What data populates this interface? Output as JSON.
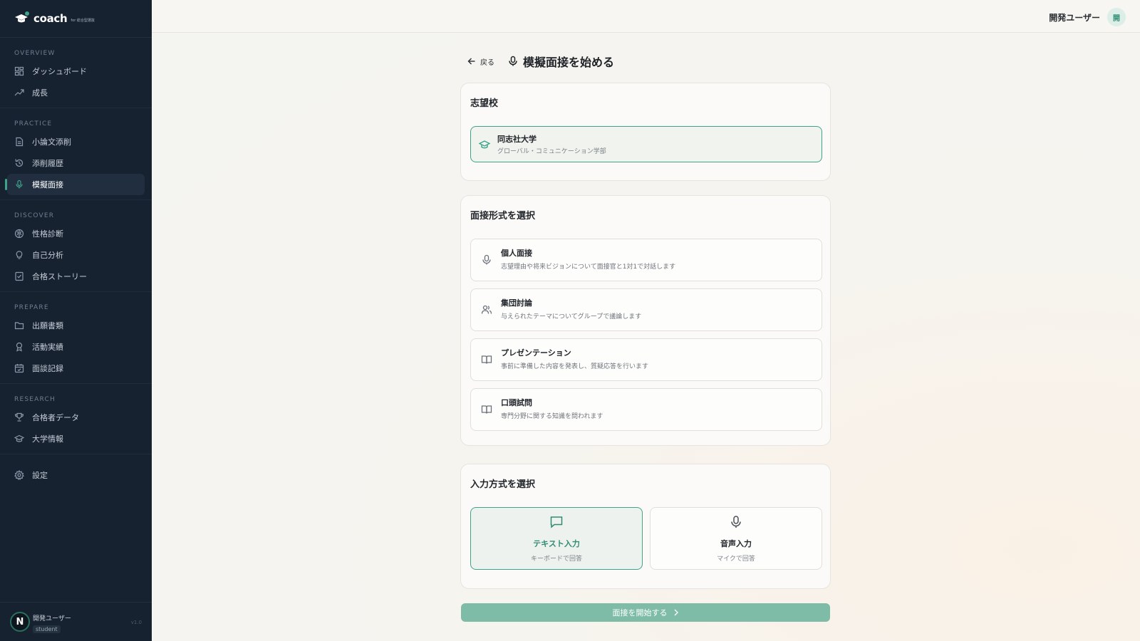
{
  "app": {
    "logo_text": "coach",
    "logo_sub": "for 総合型選抜"
  },
  "sidebar": {
    "sections": [
      {
        "title": "OVERVIEW",
        "items": [
          {
            "label": "ダッシュボード",
            "icon": "dashboard-icon"
          },
          {
            "label": "成長",
            "icon": "trend-up-icon"
          }
        ]
      },
      {
        "title": "PRACTICE",
        "items": [
          {
            "label": "小論文添削",
            "icon": "document-icon"
          },
          {
            "label": "添削履歴",
            "icon": "history-icon"
          },
          {
            "label": "模擬面接",
            "icon": "mic-icon",
            "active": true
          }
        ]
      },
      {
        "title": "DISCOVER",
        "items": [
          {
            "label": "性格診断",
            "icon": "brain-icon"
          },
          {
            "label": "自己分析",
            "icon": "lightbulb-icon"
          },
          {
            "label": "合格ストーリー",
            "icon": "checklist-icon"
          }
        ]
      },
      {
        "title": "PREPARE",
        "items": [
          {
            "label": "出願書類",
            "icon": "folder-icon"
          },
          {
            "label": "活動実績",
            "icon": "award-icon"
          },
          {
            "label": "面談記録",
            "icon": "calendar-icon"
          }
        ]
      },
      {
        "title": "RESEARCH",
        "items": [
          {
            "label": "合格者データ",
            "icon": "trophy-icon"
          },
          {
            "label": "大学情報",
            "icon": "graduation-cap-icon"
          }
        ]
      }
    ],
    "settings_label": "設定",
    "footer": {
      "avatar_letter": "N",
      "name": "開発ユーザー",
      "role": "student",
      "version": "v1.0"
    }
  },
  "topbar": {
    "user_name": "開発ユーザー",
    "avatar_char": "開"
  },
  "page": {
    "back_label": "戻る",
    "title": "模擬面接を始める"
  },
  "school_card": {
    "title": "志望校",
    "school_name": "同志社大学",
    "department": "グローバル・コミュニケーション学部"
  },
  "format_card": {
    "title": "面接形式を選択",
    "options": [
      {
        "title": "個人面接",
        "desc": "志望理由や将来ビジョンについて面接官と1対1で対話します",
        "icon": "mic-icon"
      },
      {
        "title": "集団討論",
        "desc": "与えられたテーマについてグループで議論します",
        "icon": "users-icon"
      },
      {
        "title": "プレゼンテーション",
        "desc": "事前に準備した内容を発表し、質疑応答を行います",
        "icon": "book-icon"
      },
      {
        "title": "口頭試問",
        "desc": "専門分野に関する知識を問われます",
        "icon": "book-icon"
      }
    ]
  },
  "input_card": {
    "title": "入力方式を選択",
    "options": [
      {
        "title": "テキスト入力",
        "desc": "キーボードで回答",
        "icon": "chat-icon",
        "selected": true
      },
      {
        "title": "音声入力",
        "desc": "マイクで回答",
        "icon": "mic-icon",
        "selected": false
      }
    ]
  },
  "start_button": {
    "label": "面接を開始する"
  },
  "colors": {
    "sidebar_bg": "#172231",
    "accent": "#3ea389",
    "button_bg": "#7fbca8"
  }
}
